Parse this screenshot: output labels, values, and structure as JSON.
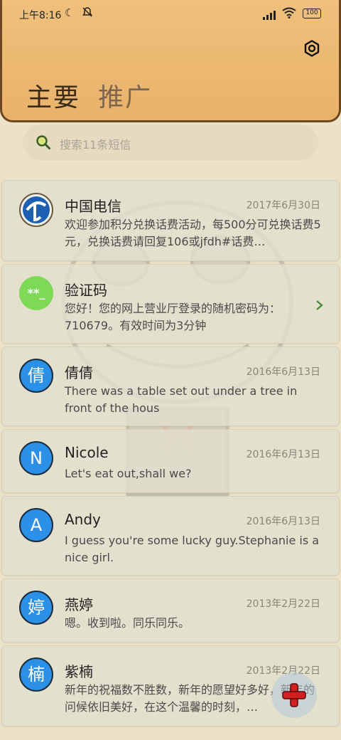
{
  "status_bar": {
    "time": "上午8:16",
    "moon_icon": "☾",
    "mute_icon": "🔕",
    "wifi_icon": "◉",
    "battery": "100"
  },
  "header": {
    "tabs": [
      "主要",
      "推广"
    ]
  },
  "search": {
    "placeholder": "搜索11条短信"
  },
  "messages": [
    {
      "name": "中国电信",
      "date": "2017年6月30日",
      "preview": "欢迎参加积分兑换话费活动，每500分可兑换话费5元，兑换话费请回复106或jfdh#话费…",
      "avatar": ""
    },
    {
      "name": "验证码",
      "date": "",
      "preview": "您好！您的网上营业厅登录的随机密码为：710679。有效时间为3分钟",
      "avatar": "**_"
    },
    {
      "name": "倩倩",
      "date": "2016年6月13日",
      "preview": "There was a table set out under a tree in front of the hous",
      "avatar": "倩"
    },
    {
      "name": "Nicole",
      "date": "2016年6月13日",
      "preview": "Let's eat out,shall we?",
      "avatar": "N"
    },
    {
      "name": "Andy",
      "date": "2016年6月13日",
      "preview": "I guess you're some lucky guy.Stephanie is a nice girl.",
      "avatar": "A"
    },
    {
      "name": "燕婷",
      "date": "2013年2月22日",
      "preview": "嗯。收到啦。同乐同乐。",
      "avatar": "婷"
    },
    {
      "name": "紫楠",
      "date": "2013年2月22日",
      "preview": "新年的祝福数不胜数，新年的愿望好多好，新年的问候依旧美好，在这个温馨的时刻，…",
      "avatar": "楠"
    }
  ]
}
